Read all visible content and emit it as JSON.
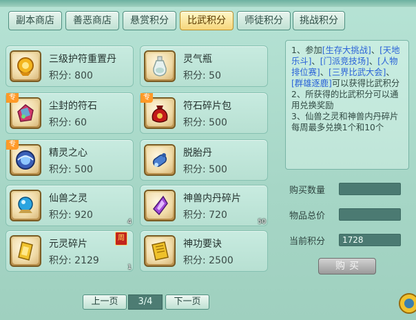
{
  "tabs": [
    {
      "label": "副本商店",
      "active": false
    },
    {
      "label": "善恶商店",
      "active": false
    },
    {
      "label": "悬赏积分",
      "active": false
    },
    {
      "label": "比武积分",
      "active": true
    },
    {
      "label": "师徒积分",
      "active": false
    },
    {
      "label": "挑战积分",
      "active": false
    }
  ],
  "items": [
    {
      "name": "三级护符重置丹",
      "points": "积分: 800",
      "icon": "gold-amulet-pill-icon"
    },
    {
      "name": "灵气瓶",
      "points": "积分: 50",
      "icon": "spirit-bottle-icon"
    },
    {
      "name": "尘封的符石",
      "points": "积分: 60",
      "icon": "rune-stone-icon",
      "tag": "专"
    },
    {
      "name": "符石碎片包",
      "points": "积分: 500",
      "icon": "rune-fragment-bag-icon",
      "tag": "专"
    },
    {
      "name": "精灵之心",
      "points": "积分: 500",
      "icon": "spirit-heart-icon",
      "tag": "专"
    },
    {
      "name": "脱胎丹",
      "points": "积分: 500",
      "icon": "rebirth-pill-icon"
    },
    {
      "name": "仙兽之灵",
      "points": "积分: 920",
      "icon": "beast-spirit-orb-icon",
      "count": "4"
    },
    {
      "name": "神兽内丹碎片",
      "points": "积分: 720",
      "icon": "beast-core-shard-icon",
      "count": "50"
    },
    {
      "name": "元灵碎片",
      "points": "积分: 2129",
      "icon": "yuanling-shard-icon",
      "count": "1",
      "weekly": "周"
    },
    {
      "name": "神功要诀",
      "points": "积分: 2500",
      "icon": "skill-manual-icon"
    }
  ],
  "pager": {
    "prev": "上一页",
    "page": "3/4",
    "next": "下一页"
  },
  "rules": {
    "l1a": "1、参加",
    "l1b": "[生存大挑战]",
    "l1c": "、",
    "l1d": "[天地乐斗]",
    "l1e": "、",
    "l1f": "[门派竞技场]",
    "l1g": "、",
    "l1h": "[人物排位赛]",
    "l1i": "、",
    "l1j": "[三界比武大会]",
    "l1k": "、",
    "l1l": "[群雄逐鹿]",
    "l1m": "可以获得比武积分",
    "l2": "2、所获得的比武积分可以通用兑换奖励",
    "l3": "3、仙兽之灵和神兽内丹碎片每周最多兑换1个和10个"
  },
  "form": {
    "qty_label": "购买数量",
    "qty_value": "",
    "total_label": "物品总价",
    "total_value": "",
    "current_label": "当前积分",
    "current_value": "1728",
    "buy_label": "购买"
  },
  "colors": {
    "accent_tab": "#f6d67a",
    "link": "#2a63d8",
    "field_bg": "#4b7a72"
  }
}
